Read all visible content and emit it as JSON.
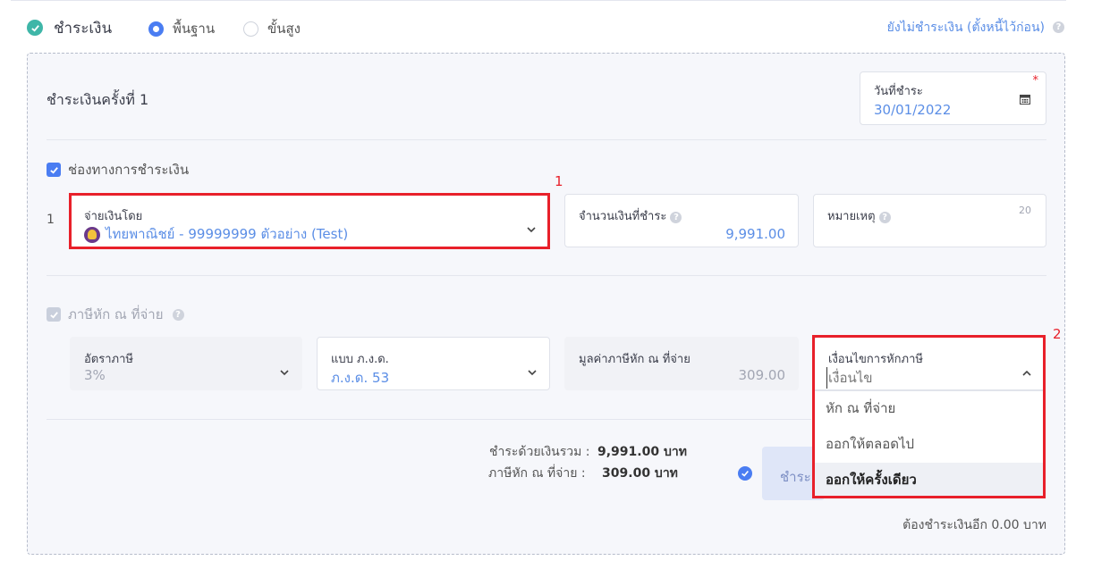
{
  "header": {
    "title": "ชำระเงิน",
    "mode_basic": "พื้นฐาน",
    "mode_advanced": "ขั้นสูง",
    "unpaid_link": "ยังไม่ชำระเงิน (ตั้งหนี้ไว้ก่อน)"
  },
  "payment": {
    "title": "ชำระเงินครั้งที่ 1",
    "date_label": "วันที่ชำระ",
    "date_value": "30/01/2022",
    "channel_checkbox": "ช่องทางการชำระเงิน",
    "row_number": "1",
    "paid_by_label": "จ่ายเงินโดย",
    "paid_by_value": "ไทยพาณิชย์ - 99999999 ตัวอย่าง (Test)",
    "amount_label": "จำนวนเงินที่ชำระ",
    "amount_value": "9,991.00",
    "note_label": "หมายเหตุ",
    "note_counter": "20"
  },
  "withholding": {
    "checkbox": "ภาษีหัก ณ ที่จ่าย",
    "rate_label": "อัตราภาษี",
    "rate_value": "3%",
    "form_label": "แบบ ภ.ง.ด.",
    "form_value": "ภ.ง.ด. 53",
    "amount_label": "มูลค่าภาษีหัก ณ ที่จ่าย",
    "amount_value": "309.00",
    "condition_label": "เงื่อนไขการหักภาษี",
    "condition_placeholder": "เงื่อนไข",
    "condition_options": [
      "หัก ณ ที่จ่าย",
      "ออกให้ตลอดไป",
      "ออกให้ครั้งเดียว"
    ]
  },
  "summary": {
    "total_label": "ชำระด้วยเงินรวม :",
    "total_value": "9,991.00 บาท",
    "wht_label": "ภาษีหัก ณ ที่จ่าย :",
    "wht_value": "309.00 บาท",
    "pay_button": "ชำระ",
    "remaining": "ต้องชำระเงินอีก 0.00 บาท"
  },
  "annotations": {
    "one": "1",
    "two": "2"
  },
  "colors": {
    "accent": "#4a7df2",
    "teal": "#3fb6a8",
    "highlight_red": "#e8202a",
    "link": "#5b8ee6"
  }
}
